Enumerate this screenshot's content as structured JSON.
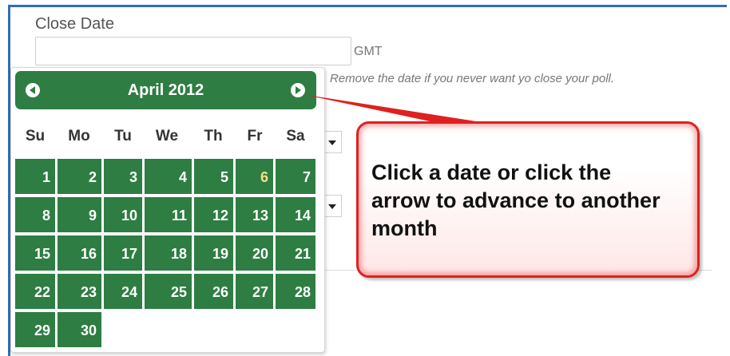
{
  "form": {
    "close_date_label": "Close Date",
    "close_date_value": "",
    "gmt_label": "GMT",
    "hint": "Remove the date if you never want yo close your poll."
  },
  "calendar": {
    "month_title": "April 2012",
    "prev_icon": "chevron-left-icon",
    "next_icon": "chevron-right-icon",
    "header_color": "#2e7d43",
    "day_color": "#2e7d43",
    "today_color": "#f2e08a",
    "weekdays": [
      "Su",
      "Mo",
      "Tu",
      "We",
      "Th",
      "Fr",
      "Sa"
    ],
    "weeks": [
      [
        "1",
        "2",
        "3",
        "4",
        "5",
        "6",
        "7"
      ],
      [
        "8",
        "9",
        "10",
        "11",
        "12",
        "13",
        "14"
      ],
      [
        "15",
        "16",
        "17",
        "18",
        "19",
        "20",
        "21"
      ],
      [
        "22",
        "23",
        "24",
        "25",
        "26",
        "27",
        "28"
      ],
      [
        "29",
        "30"
      ]
    ],
    "highlighted_day": "6"
  },
  "callout": {
    "text": "Click a date or click the arrow to advance to another month",
    "border_color": "#e02020"
  }
}
